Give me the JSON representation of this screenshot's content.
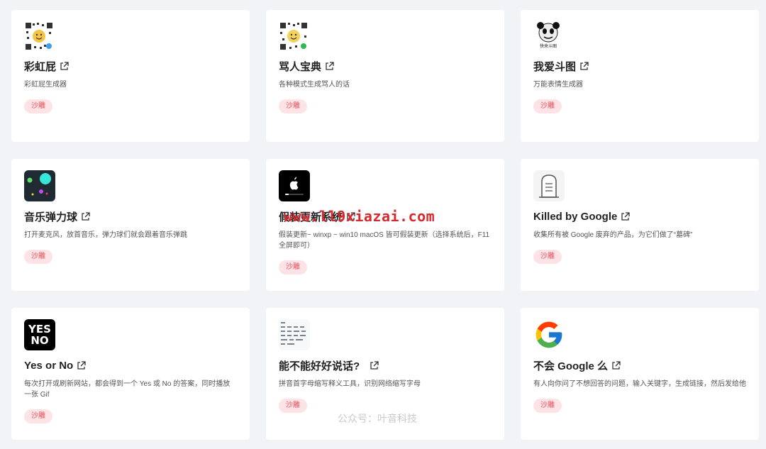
{
  "cards": [
    {
      "title": "彩虹屁",
      "desc": "彩虹屁生成器",
      "tag": "沙雕",
      "icon": "qr-sun-icon"
    },
    {
      "title": "骂人宝典",
      "desc": "各种模式生成骂人的话",
      "tag": "沙雕",
      "icon": "qr-smiley-icon"
    },
    {
      "title": "我爱斗图",
      "desc": "万能表情生成器",
      "tag": "沙雕",
      "icon": "panda-meme-icon",
      "icon_caption": "快来斗图"
    },
    {
      "title": "音乐弹力球",
      "desc": "打开麦克风，放首音乐，弹力球们就会跟着音乐弹跳",
      "tag": "沙雕",
      "icon": "bouncing-balls-icon"
    },
    {
      "title": "假装更新系统",
      "desc": "假装更新~ winxp ~ win10 macOS 皆可假装更新（选择系统后，F11全屏即可）",
      "tag": "沙雕",
      "icon": "apple-update-icon"
    },
    {
      "title": "Killed by Google",
      "desc": "收集所有被 Google 废弃的产品，为它们做了“墓碑”",
      "tag": "沙雕",
      "icon": "tombstone-icon"
    },
    {
      "title": "Yes or No",
      "desc": "每次打开或刷新网站，都会得到一个 Yes 或 No 的答案，同时播放一张 Gif",
      "tag": "沙雕",
      "icon": "yes-no-icon",
      "icon_text": [
        "YES",
        "NO"
      ]
    },
    {
      "title": "能不能好好说话?",
      "desc": "拼音首字母缩写释义工具，识别网络缩写字母",
      "tag": "沙雕",
      "icon": "abbreviation-table-icon"
    },
    {
      "title": "不会 Google 么",
      "desc": "有人向你问了不想回答的问题，输入关键字，生成链接，然后发给他",
      "tag": "沙雕",
      "icon": "google-g-icon"
    }
  ],
  "watermark": "www.ll9xiazai.com",
  "footer": "公众号：叶音科技",
  "colors": {
    "background": "#f1f3f6",
    "tag_bg": "#fde3e5",
    "tag_text": "#e2505c",
    "watermark": "#d8282e"
  }
}
